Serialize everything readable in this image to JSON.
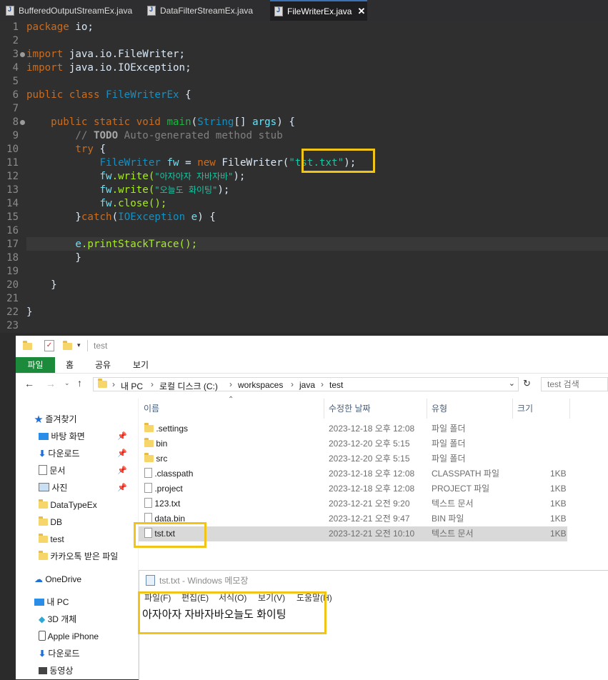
{
  "editor": {
    "tabs": [
      {
        "label": "BufferedOutputStreamEx.java",
        "active": false
      },
      {
        "label": "DataFilterStreamEx.java",
        "active": false
      },
      {
        "label": "FileWriterEx.java",
        "active": true
      }
    ],
    "line_numbers": [
      "1",
      "2",
      "3",
      "4",
      "5",
      "6",
      "7",
      "8",
      "9",
      "10",
      "11",
      "12",
      "13",
      "14",
      "15",
      "16",
      "17",
      "18",
      "19",
      "20",
      "21",
      "22",
      "23"
    ],
    "code": {
      "l1_kw": "package",
      "l1_rest": " io;",
      "l3_kw": "import",
      "l3_rest": " java.io.FileWriter;",
      "l4_kw": "import",
      "l4_rest": " java.io.IOException;",
      "l6_kw": "public class",
      "l6_cls": "FileWriterEx",
      "l6_rest": " {",
      "l8_kw": "public static void",
      "l8_fn": "main",
      "l8_p1": "(",
      "l8_type": "String",
      "l8_p2": "[] ",
      "l8_arg": "args",
      "l8_p3": ") {",
      "l9_c1": "// ",
      "l9_todo": "TODO",
      "l9_c2": " Auto-generated method stub",
      "l10_kw": "try",
      "l10_rest": " {",
      "l11_type": "FileWriter",
      "l11_var": "fw",
      "l11_eq": " = ",
      "l11_new": "new",
      "l11_ctor": " FileWriter(",
      "l11_str": "\"tst.txt\"",
      "l11_end": ");",
      "l12_var": "fw",
      "l12_call": ".write(",
      "l12_str": "\"아자아자 자바자바\"",
      "l12_end": ");",
      "l13_var": "fw",
      "l13_call": ".write(",
      "l13_str": "\"오늘도 화이팅\"",
      "l13_end": ");",
      "l14_var": "fw",
      "l14_call": ".close();",
      "l15_p1": "}",
      "l15_kw": "catch",
      "l15_p2": "(",
      "l15_type": "IOException",
      "l15_arg": " e",
      "l15_p3": ") {",
      "l17_var": "e",
      "l17_call": ".printStackTrace();",
      "l18": "}",
      "l20": "}",
      "l22": "}"
    }
  },
  "explorer": {
    "qat_path": "test",
    "ribbon_tabs": [
      "파일",
      "홈",
      "공유",
      "보기"
    ],
    "breadcrumb": [
      "내 PC",
      "로컬 디스크 (C:)",
      "workspaces",
      "java",
      "test"
    ],
    "search_placeholder": "test 검색",
    "columns": [
      "이름",
      "수정한 날짜",
      "유형",
      "크기"
    ],
    "nav": [
      {
        "label": "즐겨찾기",
        "icon": "star-icon"
      },
      {
        "label": "바탕 화면",
        "icon": "desktop-icon",
        "pinned": true
      },
      {
        "label": "다운로드",
        "icon": "download-icon",
        "pinned": true
      },
      {
        "label": "문서",
        "icon": "document-icon",
        "pinned": true
      },
      {
        "label": "사진",
        "icon": "picture-icon",
        "pinned": true
      },
      {
        "label": "DataTypeEx",
        "icon": "folder-icon"
      },
      {
        "label": "DB",
        "icon": "folder-icon"
      },
      {
        "label": "test",
        "icon": "folder-icon"
      },
      {
        "label": "카카오톡 받은 파일",
        "icon": "folder-icon"
      },
      {
        "label": "OneDrive",
        "icon": "cloud-icon"
      },
      {
        "label": "내 PC",
        "icon": "computer-icon"
      },
      {
        "label": "3D 개체",
        "icon": "cube-icon"
      },
      {
        "label": "Apple iPhone",
        "icon": "phone-icon"
      },
      {
        "label": "다운로드",
        "icon": "download-icon"
      },
      {
        "label": "동영상",
        "icon": "video-icon"
      }
    ],
    "files": [
      {
        "name": ".settings",
        "date": "2023-12-18 오후 12:08",
        "type": "파일 폴더",
        "size": "",
        "kind": "folder"
      },
      {
        "name": "bin",
        "date": "2023-12-20 오후 5:15",
        "type": "파일 폴더",
        "size": "",
        "kind": "folder"
      },
      {
        "name": "src",
        "date": "2023-12-20 오후 5:15",
        "type": "파일 폴더",
        "size": "",
        "kind": "folder"
      },
      {
        "name": ".classpath",
        "date": "2023-12-18 오후 12:08",
        "type": "CLASSPATH 파일",
        "size": "1KB",
        "kind": "file"
      },
      {
        "name": ".project",
        "date": "2023-12-18 오후 12:08",
        "type": "PROJECT 파일",
        "size": "1KB",
        "kind": "file"
      },
      {
        "name": "123.txt",
        "date": "2023-12-21 오전 9:20",
        "type": "텍스트 문서",
        "size": "1KB",
        "kind": "file"
      },
      {
        "name": "data.bin",
        "date": "2023-12-21 오전 9:47",
        "type": "BIN 파일",
        "size": "1KB",
        "kind": "file"
      },
      {
        "name": "tst.txt",
        "date": "2023-12-21 오전 10:10",
        "type": "텍스트 문서",
        "size": "1KB",
        "kind": "file",
        "selected": true
      }
    ]
  },
  "notepad": {
    "title": "tst.txt - Windows 메모장",
    "menu": [
      "파일(F)",
      "편집(E)",
      "서식(O)",
      "보기(V)",
      "도움말(H)"
    ],
    "content": "아자아자 자바자바오늘도 화이팅"
  },
  "colors": {
    "highlight_box": "#f0c419",
    "ribbon_file_tab": "#1b8a3b",
    "editor_bg": "#2f2f2f"
  }
}
